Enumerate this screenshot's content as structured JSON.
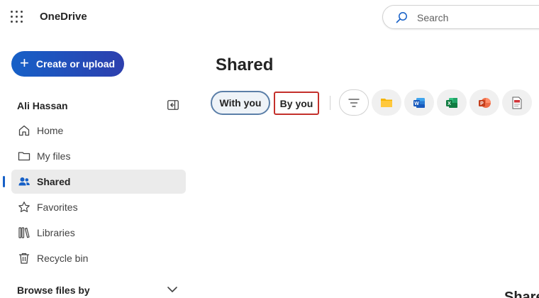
{
  "app": {
    "title": "OneDrive"
  },
  "search": {
    "placeholder": "Search"
  },
  "create": {
    "label": "Create or upload"
  },
  "user": {
    "name": "Ali Hassan"
  },
  "nav": {
    "items": [
      {
        "label": "Home",
        "icon": "home-icon"
      },
      {
        "label": "My files",
        "icon": "folder-icon"
      },
      {
        "label": "Shared",
        "icon": "people-icon",
        "active": true
      },
      {
        "label": "Favorites",
        "icon": "star-icon"
      },
      {
        "label": "Libraries",
        "icon": "library-icon"
      },
      {
        "label": "Recycle bin",
        "icon": "trash-icon"
      }
    ]
  },
  "browse": {
    "label": "Browse files by"
  },
  "main": {
    "title": "Shared",
    "tabs": [
      {
        "label": "With you",
        "selected": true
      },
      {
        "label": "By you",
        "selected": false
      }
    ],
    "filters": [
      "filter-icon",
      "folder-icon",
      "word-icon",
      "excel-icon",
      "powerpoint-icon",
      "pdf-icon"
    ],
    "bottom_fragment": "Share"
  },
  "colors": {
    "accent": "#1660c7",
    "word": "#185abd",
    "excel": "#107c41",
    "powerpoint": "#c43e1c",
    "folder": "#f4b400",
    "highlight": "#c4302b"
  }
}
